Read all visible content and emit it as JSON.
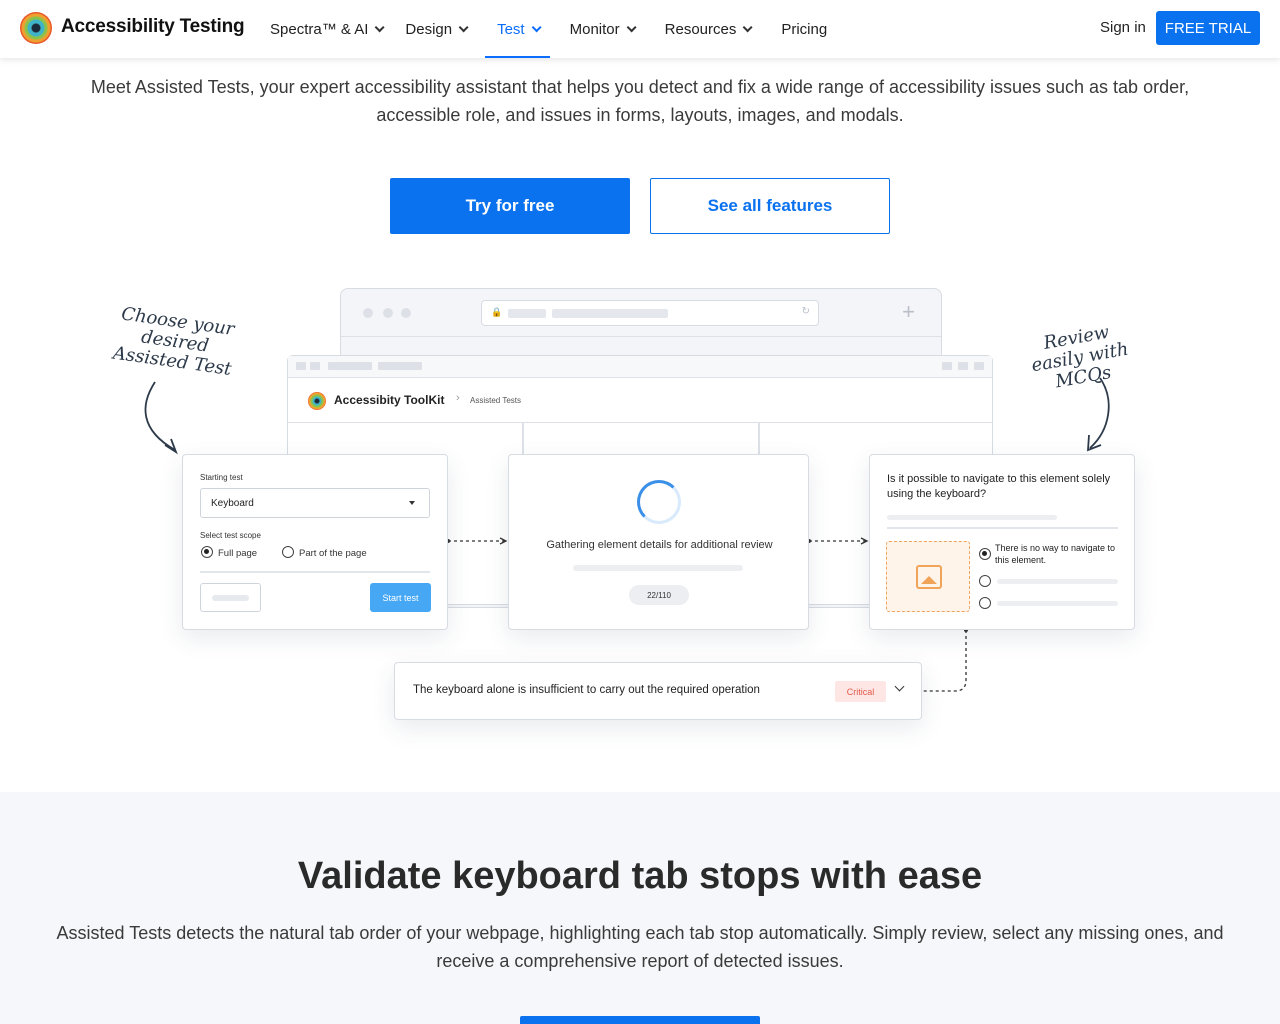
{
  "header": {
    "brand": "Accessibility Testing",
    "nav": [
      {
        "label": "Spectra™ & AI",
        "dropdown": true
      },
      {
        "label": "Design",
        "dropdown": true
      },
      {
        "label": "Test",
        "dropdown": true,
        "active": true
      },
      {
        "label": "Monitor",
        "dropdown": true
      },
      {
        "label": "Resources",
        "dropdown": true
      },
      {
        "label": "Pricing",
        "dropdown": false
      }
    ],
    "signin": "Sign in",
    "trial": "FREE TRIAL"
  },
  "intro": {
    "text": "Meet Assisted Tests, your expert accessibility assistant that helps you detect and fix a wide range of accessibility issues such as tab order, accessible role, and issues in forms, layouts, images, and modals.",
    "primary_cta": "Try for free",
    "secondary_cta": "See all features"
  },
  "illustration": {
    "annotation_left": "Choose your desired Assisted Test",
    "annotation_right": "Review easily with MCQs",
    "toolkit_name": "Accessibity ToolKit",
    "breadcrumb": "Assisted Tests",
    "card1": {
      "starting_label": "Starting test",
      "select_value": "Keyboard",
      "scope_label": "Select test scope",
      "option_full": "Full page",
      "option_part": "Part of the page",
      "start_button": "Start test"
    },
    "card2": {
      "status": "Gathering element details for additional review",
      "progress": "22/110"
    },
    "card3": {
      "question": "Is it possible to navigate to this element solely using the keyboard?",
      "option1": "There is no way to navigate to this element."
    },
    "issue": {
      "text": "The keyboard alone is insufficient to carry out the required operation",
      "severity": "Critical"
    }
  },
  "section2": {
    "title": "Validate keyboard tab stops with ease",
    "text": "Assisted Tests detects the natural tab order of your webpage, highlighting each tab stop automatically. Simply review, select any missing ones, and receive a comprehensive report of detected issues."
  },
  "colors": {
    "accent": "#0a72ef",
    "critical_text": "#e25a4a",
    "critical_bg": "#fde6e3"
  }
}
